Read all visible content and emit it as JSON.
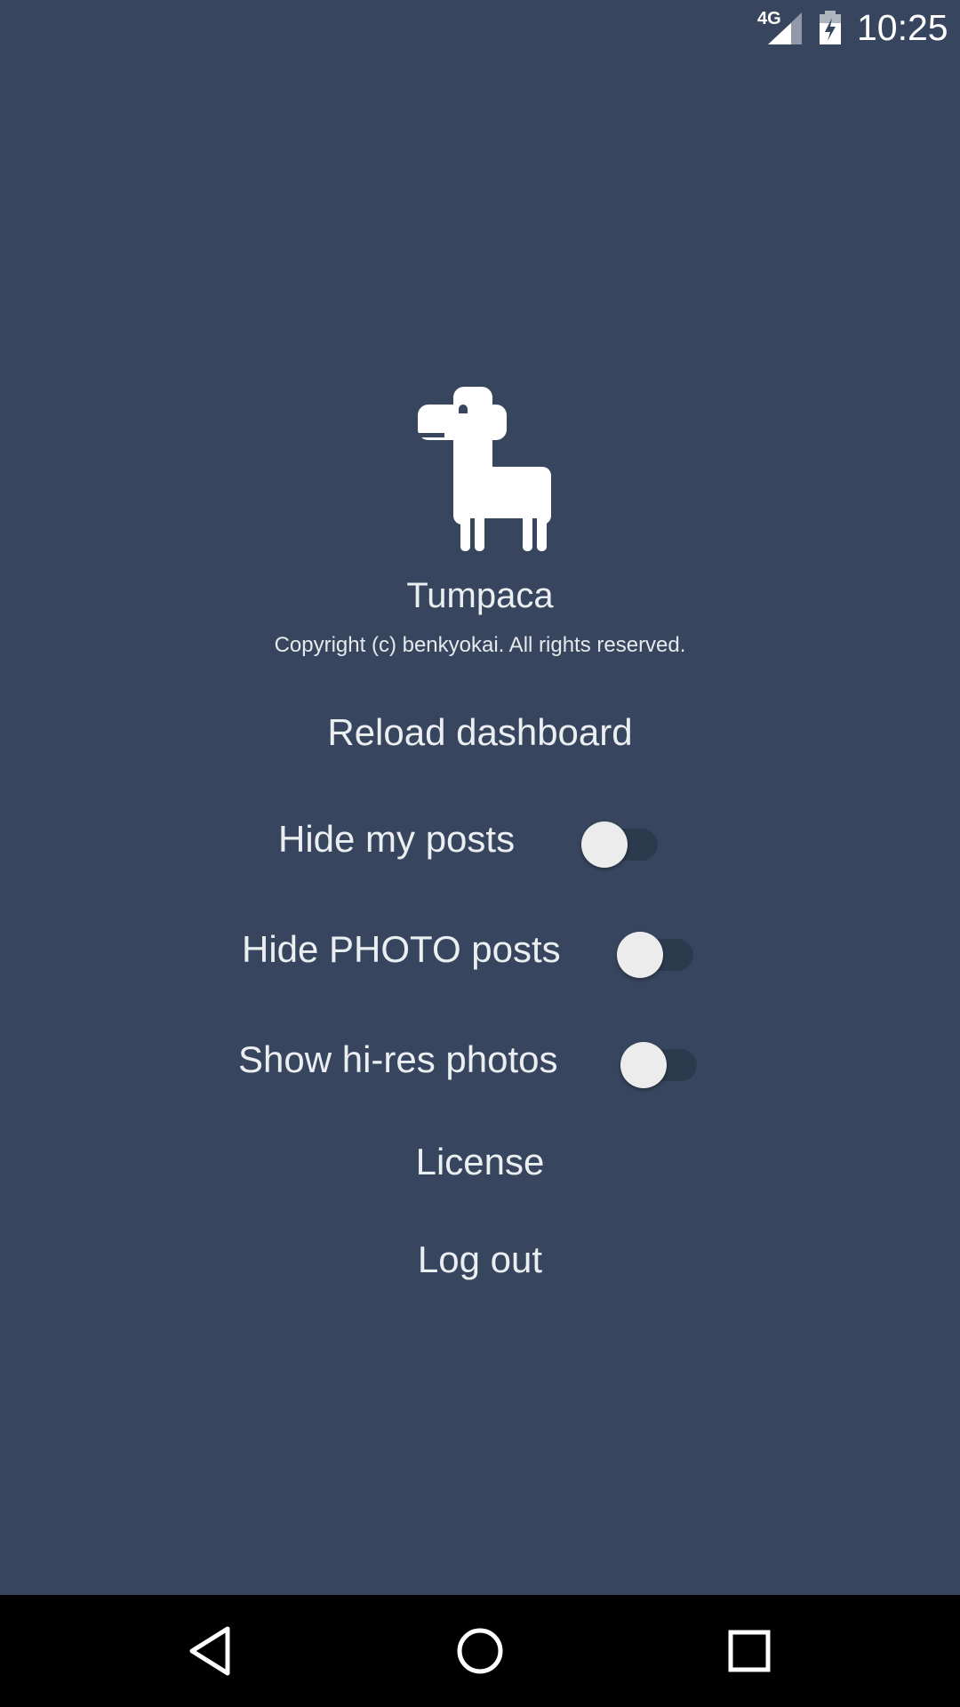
{
  "status_bar": {
    "network": "4G",
    "time": "10:25",
    "icons": [
      "signal-icon",
      "battery-charging-icon"
    ]
  },
  "app": {
    "logo_icon": "alpaca-logo-icon",
    "name": "Tumpaca",
    "copyright": "Copyright (c) benkyokai. All rights reserved."
  },
  "menu": {
    "reload_label": "Reload dashboard",
    "toggles": [
      {
        "label": "Hide my posts",
        "on": false
      },
      {
        "label": "Hide PHOTO posts",
        "on": false
      },
      {
        "label": "Show hi-res photos",
        "on": false
      }
    ],
    "license_label": "License",
    "logout_label": "Log out"
  },
  "nav_bar": {
    "buttons": [
      "back-icon",
      "home-icon",
      "recents-icon"
    ]
  },
  "colors": {
    "background": "#37465e",
    "text": "#eceff1",
    "switch_track": "#2c3a4d",
    "switch_thumb": "#ececec",
    "nav_bar": "#000000"
  }
}
